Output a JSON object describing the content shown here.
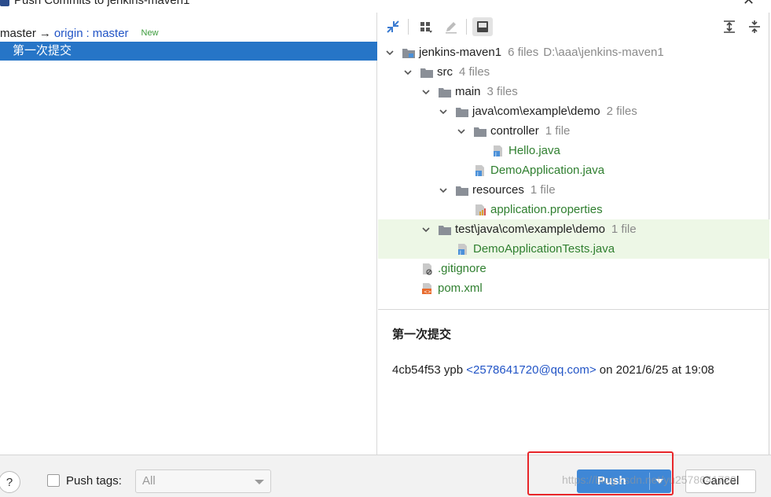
{
  "window": {
    "title": "Push Commits to jenkins-maven1"
  },
  "left": {
    "branch": {
      "local": "master",
      "arrow": "→",
      "remote": "origin",
      "separator": ":",
      "remote_branch": "master",
      "badge": "New"
    },
    "commit": {
      "subject": "第一次提交"
    }
  },
  "toolbar": {
    "buttons": [
      "expand-collapse-icon",
      "group-by-icon",
      "edit-icon",
      "preview-icon",
      "expand-all-icon",
      "collapse-all-icon"
    ]
  },
  "tree": {
    "root": {
      "name": "jenkins-maven1",
      "count": "6 files",
      "path": "D:\\aaa\\jenkins-maven1"
    },
    "src": {
      "name": "src",
      "count": "4 files"
    },
    "main": {
      "name": "main",
      "count": "3 files"
    },
    "java_pkg": {
      "name": "java\\com\\example\\demo",
      "count": "2 files"
    },
    "controller": {
      "name": "controller",
      "count": "1 file"
    },
    "hello": {
      "name": "Hello.java"
    },
    "demo_app": {
      "name": "DemoApplication.java"
    },
    "resources": {
      "name": "resources",
      "count": "1 file"
    },
    "app_props": {
      "name": "application.properties"
    },
    "test_pkg": {
      "name": "test\\java\\com\\example\\demo",
      "count": "1 file"
    },
    "demo_tests": {
      "name": "DemoApplicationTests.java"
    },
    "gitignore": {
      "name": ".gitignore"
    },
    "pom": {
      "name": "pom.xml"
    }
  },
  "details": {
    "subject": "第一次提交",
    "hash": "4cb54f53",
    "author": "ypb",
    "email": "<2578641720@qq.com>",
    "date_text": "on 2021/6/25 at 19:08"
  },
  "bottom": {
    "help": "?",
    "push_tags_label": "Push tags:",
    "tags_value": "All",
    "push_label": "Push",
    "cancel_label": "Cancel"
  },
  "watermark": "https://blog.csdn.net/yu2578641720",
  "colors": {
    "selection": "#2675c7",
    "push_button": "#3f87d6",
    "added_file": "#2f7f2f",
    "highlight_row": "#edf7e6",
    "annotation_box": "#e8262a"
  }
}
